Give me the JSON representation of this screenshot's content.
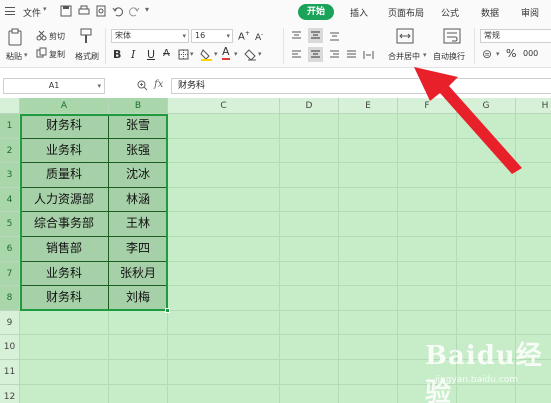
{
  "menubar": {
    "file_label": "文件",
    "tabs": [
      {
        "label": "开始",
        "active": true
      },
      {
        "label": "插入",
        "active": false
      },
      {
        "label": "页面布局",
        "active": false
      },
      {
        "label": "公式",
        "active": false
      },
      {
        "label": "数据",
        "active": false
      },
      {
        "label": "审阅",
        "active": false
      }
    ]
  },
  "ribbon": {
    "paste_label": "粘贴",
    "cut_label": "剪切",
    "copy_label": "复制",
    "format_painter_label": "格式刷",
    "font_name": "宋体",
    "font_size": "16",
    "bold": "B",
    "italic": "I",
    "underline": "U",
    "merge_center_label": "合并居中",
    "wrap_text_label": "自动换行",
    "number_format": "常规",
    "percent": "%",
    "thousands": "000"
  },
  "formula_bar": {
    "name_box": "A1",
    "fx_label": "fx",
    "content": "财务科"
  },
  "sheet": {
    "columns": [
      "A",
      "B",
      "C",
      "D",
      "E",
      "F",
      "G",
      "H"
    ],
    "rows": [
      "1",
      "2",
      "3",
      "4",
      "5",
      "6",
      "7",
      "8",
      "9",
      "10",
      "11",
      "12"
    ],
    "data": [
      [
        "财务科",
        "张雪"
      ],
      [
        "业务科",
        "张强"
      ],
      [
        "质量科",
        "沈冰"
      ],
      [
        "人力资源部",
        "林涵"
      ],
      [
        "综合事务部",
        "王林"
      ],
      [
        "销售部",
        "李四"
      ],
      [
        "业务科",
        "张秋月"
      ],
      [
        "财务科",
        "刘梅"
      ]
    ]
  },
  "watermark": {
    "logo_text": "Baidu经验",
    "url": "jingyan.baidu.com"
  },
  "colors": {
    "accent": "#1aa45a",
    "grid_background": "#c6ecc8",
    "selected_cell": "#a6d0a8",
    "arrow": "#e8202a"
  }
}
